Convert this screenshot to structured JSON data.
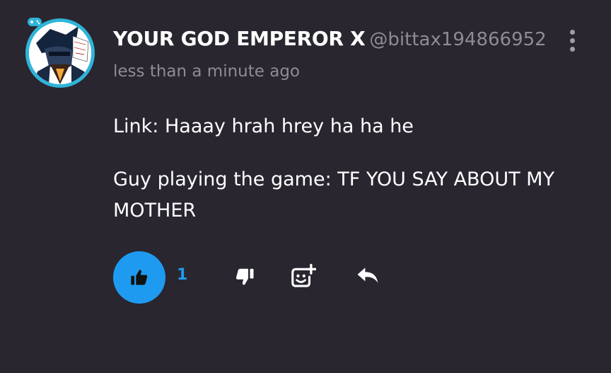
{
  "comment": {
    "author_name": "YOUR GOD EMPEROR X",
    "author_handle": "@bittax194866952",
    "timestamp": "less than a minute ago",
    "body_lines": [
      "Link: Haaay hrah hrey ha ha he",
      "Guy playing the game: TF YOU SAY ABOUT MY MOTHER"
    ],
    "like_count": "1",
    "liked": true
  },
  "colors": {
    "background": "#29262f",
    "accent": "#1e9bf0",
    "muted_text": "#8f8b94",
    "avatar_ring": "#2fb4d8"
  },
  "icons": {
    "more": "more-vertical-icon",
    "like": "thumbs-up-icon",
    "dislike": "thumbs-down-icon",
    "react": "add-reaction-icon",
    "reply": "reply-icon"
  }
}
